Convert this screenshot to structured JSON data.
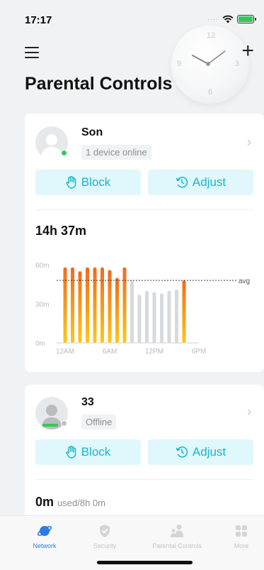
{
  "status_bar": {
    "time": "17:17"
  },
  "header": {
    "title": "Parental Controls",
    "add_icon": "plus-icon",
    "menu_icon": "hamburger-menu-icon"
  },
  "clock": {
    "numbers": [
      "12",
      "3",
      "6",
      "9"
    ]
  },
  "profiles": [
    {
      "name": "Son",
      "status": "1 device online",
      "online": true,
      "block_label": "Block",
      "adjust_label": "Adjust",
      "usage": "14h 37m"
    },
    {
      "name": "33",
      "status": "Offline",
      "online": false,
      "block_label": "Block",
      "adjust_label": "Adjust",
      "usage_value": "0m",
      "usage_limit": "used/8h 0m"
    }
  ],
  "chart_data": {
    "type": "bar",
    "y_ticks": [
      "60m",
      "30m",
      "0m"
    ],
    "x_ticks": [
      "12AM",
      "6AM",
      "12PM",
      "6PM"
    ],
    "avg_label": "avg",
    "avg_value": 48,
    "ylim": [
      0,
      60
    ],
    "hours": [
      0,
      1,
      2,
      3,
      4,
      5,
      6,
      7,
      8,
      9,
      10,
      11,
      12,
      13,
      14,
      15,
      16,
      17
    ],
    "values": [
      58,
      58,
      55,
      58,
      58,
      58,
      56,
      50,
      58,
      48,
      37,
      40,
      39,
      38,
      40,
      41,
      48,
      0
    ],
    "highlight": [
      true,
      true,
      true,
      true,
      true,
      true,
      true,
      true,
      true,
      false,
      false,
      false,
      false,
      false,
      false,
      false,
      true,
      false
    ],
    "colors": {
      "active_top": "#f26a1b",
      "active_bottom": "#ffc61a",
      "inactive": "#d6d9de",
      "axis": "#c9ccd0"
    }
  },
  "tabs": [
    {
      "label": "Network",
      "icon": "planet-icon",
      "active": true
    },
    {
      "label": "Security",
      "icon": "shield-icon",
      "active": false
    },
    {
      "label": "Parental Controls",
      "icon": "family-icon",
      "active": false
    },
    {
      "label": "More",
      "icon": "grid-icon",
      "active": false
    }
  ],
  "colors": {
    "accent": "#18b6cc",
    "tab_active": "#2c7be5",
    "online_dot": "#2ecc52",
    "offline_dot": "#c0c2c5"
  }
}
